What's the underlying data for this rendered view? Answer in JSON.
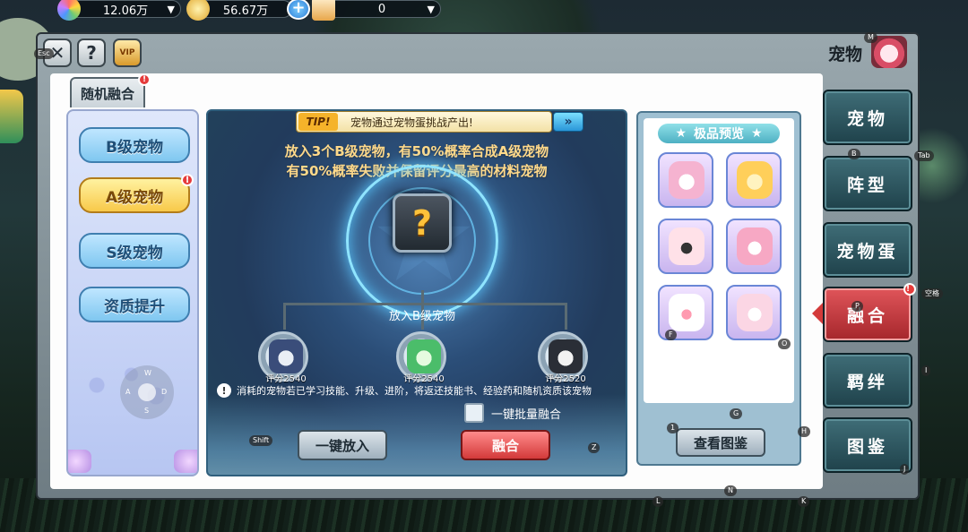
{
  "currency": {
    "gem": "12.06万",
    "gold": "56.67万",
    "ticket": "0"
  },
  "window": {
    "title": "宠物",
    "vip_label": "VIP"
  },
  "tab": {
    "label": "随机融合"
  },
  "grades": [
    {
      "label": "B级宠物",
      "active": false
    },
    {
      "label": "A级宠物",
      "active": true
    },
    {
      "label": "S级宠物",
      "active": false
    },
    {
      "label": "资质提升",
      "active": false
    }
  ],
  "joystick": {
    "up": "W",
    "left": "A",
    "right": "D",
    "down": "S"
  },
  "tip": {
    "tag": "TIP!",
    "text": "宠物通过宠物蛋挑战产出!",
    "go": "»"
  },
  "fusion": {
    "desc_line1": "放入3个B级宠物，有50%概率合成A级宠物",
    "desc_line2": "有50%概率失败并保留评分最高的材料宠物",
    "result_placeholder": "?",
    "put_label": "放入B级宠物",
    "pets": [
      {
        "score": "评分2540",
        "color": "#3a4d7a"
      },
      {
        "score": "评分2540",
        "color": "#4bbd6a"
      },
      {
        "score": "评分2520",
        "color": "#2a2e36"
      }
    ],
    "warning": "消耗的宠物若已学习技能、升级、进阶，将返还技能书、经验药和随机资质该宠物",
    "batch_label": "一键批量融合",
    "auto_put_label": "一键放入",
    "fuse_label": "融合"
  },
  "preview": {
    "title": "极品预览",
    "book_label": "查看图鉴",
    "items": [
      {
        "name": "cow-pet",
        "color": "#f5b3d0"
      },
      {
        "name": "pig-pet",
        "color": "#ffcf5a"
      },
      {
        "name": "panda-pet",
        "color": "#ffe1e8"
      },
      {
        "name": "owl-pet",
        "color": "#f7a8c4"
      },
      {
        "name": "bunny-pet",
        "color": "#ffffff"
      },
      {
        "name": "piglet-pet",
        "color": "#fbd6e4"
      }
    ]
  },
  "side_nav": [
    {
      "label": "宠物",
      "active": false,
      "key": "B"
    },
    {
      "label": "阵型",
      "active": false,
      "key": ""
    },
    {
      "label": "宠物蛋",
      "active": false,
      "key": ""
    },
    {
      "label": "融合",
      "active": true,
      "key": "P"
    },
    {
      "label": "羁绊",
      "active": false,
      "key": ""
    },
    {
      "label": "图鉴",
      "active": false,
      "key": "J"
    }
  ],
  "hotkeys": {
    "esc": "Esc",
    "m": "M",
    "tab": "Tab",
    "space": "空格",
    "i": "I",
    "shift": "Shift",
    "z": "Z",
    "g": "G",
    "h": "H",
    "one": "1",
    "f": "F",
    "o": "O",
    "l": "L",
    "n": "N",
    "k": "K"
  },
  "colors": {
    "accent_red": "#d33a3a",
    "tip_gold": "#f5b32a",
    "desc_gold": "#ffd98a"
  }
}
